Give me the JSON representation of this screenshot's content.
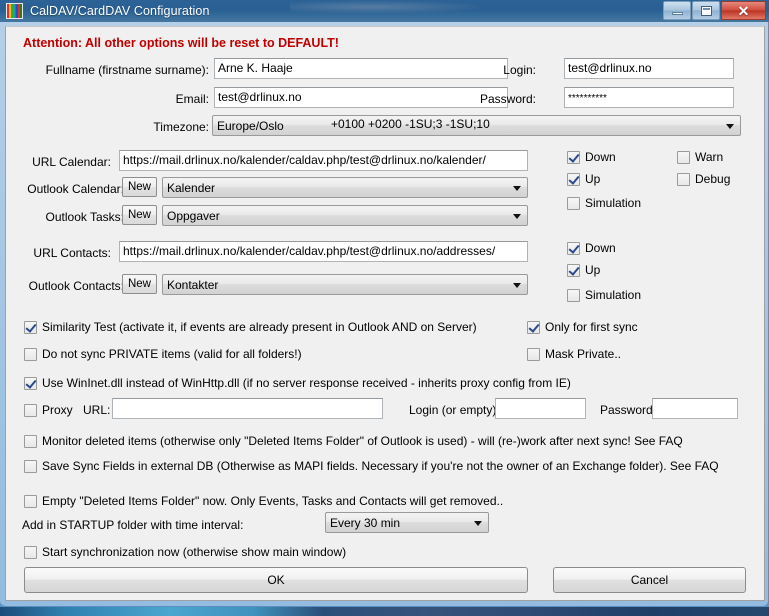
{
  "window": {
    "title": "CalDAV/CardDAV Configuration",
    "icon": "rainbow-stripes-icon",
    "controls": {
      "minimize": "minimize-icon",
      "maximize": "maximize-icon",
      "close": "close-icon",
      "close_glyph": "✕"
    }
  },
  "dialog": {
    "warning": "Attention: All other options will be reset to DEFAULT!",
    "account": {
      "fullname_label": "Fullname (firstname surname):",
      "fullname_value": "Arne K. Haaje",
      "email_label": "Email:",
      "email_value": "test@drlinux.no",
      "timezone_label": "Timezone:",
      "timezone_value": "Europe/Oslo",
      "timezone_offsets": "+0100 +0200 -1SU;3 -1SU;10",
      "login_label": "Login:",
      "login_value": "test@drlinux.no",
      "password_label": "Password:",
      "password_value": "**********"
    },
    "calendar": {
      "url_label": "URL Calendar:",
      "url_value": "https://mail.drlinux.no/kalender/caldav.php/test@drlinux.no/kalender/",
      "outlook_calendar_label": "Outlook Calendar:",
      "outlook_calendar_value": "Kalender",
      "outlook_tasks_label": "Outlook Tasks:",
      "outlook_tasks_value": "Oppgaver",
      "new_button": "New",
      "options": [
        {
          "label": "Down",
          "checked": true
        },
        {
          "label": "Warn",
          "checked": false
        },
        {
          "label": "Up",
          "checked": true
        },
        {
          "label": "Debug",
          "checked": false
        },
        {
          "label": "Simulation",
          "checked": false
        }
      ]
    },
    "contacts": {
      "url_label": "URL Contacts:",
      "url_value": "https://mail.drlinux.no/kalender/caldav.php/test@drlinux.no/addresses/",
      "outlook_contacts_label": "Outlook Contacts:",
      "outlook_contacts_value": "Kontakter",
      "new_button": "New",
      "options": [
        {
          "label": "Down",
          "checked": true
        },
        {
          "label": "Up",
          "checked": true
        },
        {
          "label": "Simulation",
          "checked": false
        }
      ]
    },
    "sync_options": {
      "similarity_test": {
        "label": "Similarity Test (activate it, if events are already present in Outlook AND on Server)",
        "checked": true
      },
      "only_first_sync": {
        "label": "Only for first sync",
        "checked": true
      },
      "no_private": {
        "label": "Do not sync PRIVATE items (valid for all folders!)",
        "checked": false
      },
      "mask_private": {
        "label": "Mask Private..",
        "checked": false
      },
      "wininet": {
        "label": "Use WinInet.dll instead of WinHttp.dll (if no server response received - inherits proxy config from IE)",
        "checked": true
      }
    },
    "proxy": {
      "checkbox_label": "Proxy",
      "checked": false,
      "url_label": "URL:",
      "url_value": "",
      "login_label": "Login (or empty):",
      "login_value": "",
      "password_label": "Password:",
      "password_value": ""
    },
    "advanced": {
      "monitor_deleted": {
        "label": "Monitor deleted items (otherwise only \"Deleted Items Folder\" of Outlook is used) - will (re-)work after next sync! See FAQ",
        "checked": false
      },
      "save_sync_fields": {
        "label": "Save Sync Fields in external DB (Otherwise as MAPI fields. Necessary if you're not the owner of an Exchange folder). See FAQ",
        "checked": false
      },
      "empty_deleted": {
        "label": "Empty \"Deleted Items Folder\" now. Only Events, Tasks and Contacts will get removed..",
        "checked": false
      },
      "startup_label": "Add in STARTUP folder with time interval:",
      "startup_value": "Every 30 min",
      "start_sync_now": {
        "label": "Start synchronization now (otherwise show main window)",
        "checked": false
      }
    },
    "footer": {
      "ok": "OK",
      "cancel": "Cancel"
    }
  }
}
